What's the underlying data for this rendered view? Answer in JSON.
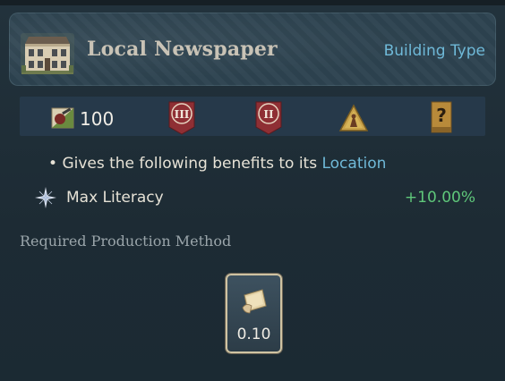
{
  "header": {
    "title": "Local Newspaper",
    "type_link": "Building Type",
    "icon": "building-icon"
  },
  "stats": {
    "cost_icon": "construction-cost-icon",
    "cost_value": "100",
    "badges": [
      {
        "icon": "tier-iii-badge-icon",
        "text": "III"
      },
      {
        "icon": "tier-ii-badge-icon",
        "text": "II"
      },
      {
        "icon": "warning-triangle-icon",
        "text": ""
      },
      {
        "icon": "question-mark-icon",
        "text": "?"
      }
    ]
  },
  "benefits": {
    "bullet": "•",
    "prefix": "Gives the following benefits to its ",
    "location_link": "Location",
    "items": [
      {
        "icon": "literacy-star-icon",
        "label": "Max Literacy",
        "value": "+10.00%"
      }
    ]
  },
  "production": {
    "section_title": "Required Production Method",
    "method": {
      "icon": "paper-icon",
      "value": "0.10"
    }
  },
  "colors": {
    "accent_link": "#6fb9d8",
    "positive": "#5fc77a",
    "badge_red": "#8f2f34",
    "gold": "#c9a24a"
  }
}
